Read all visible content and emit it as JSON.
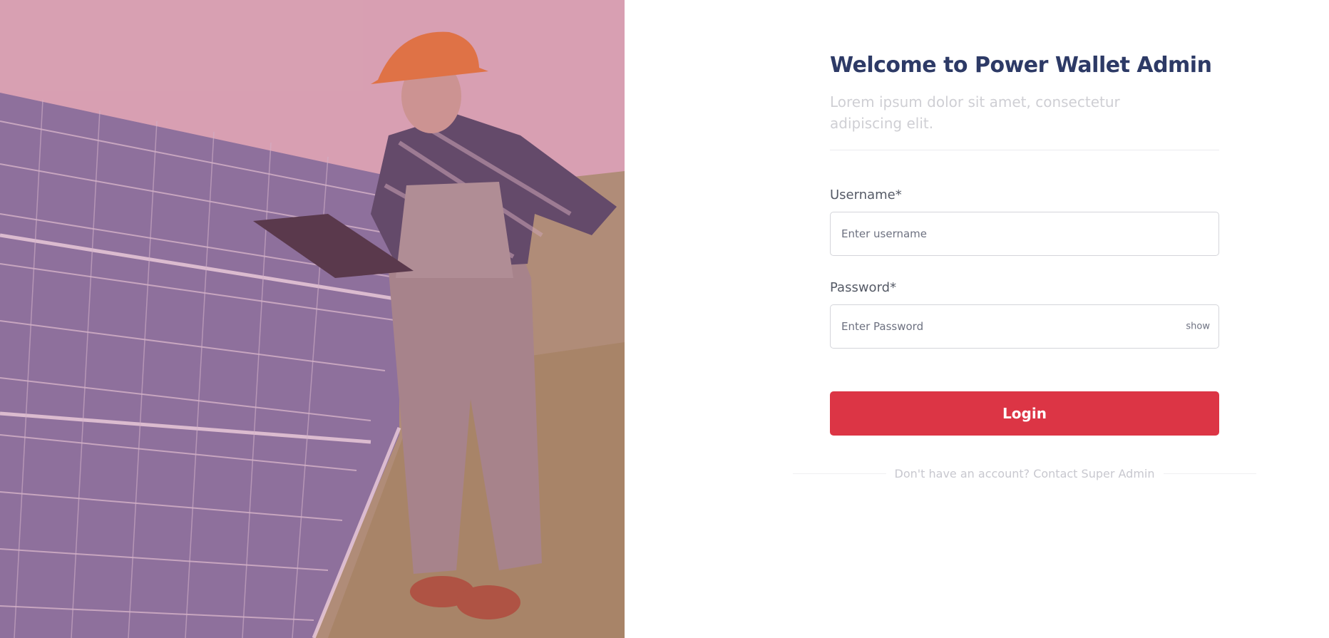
{
  "hero": {
    "image_alt": "Worker in hard hat holding clipboard beside solar panels"
  },
  "form": {
    "title": "Welcome to Power Wallet Admin",
    "subtitle": "Lorem ipsum dolor sit amet, consectetur adipiscing elit.",
    "username": {
      "label": "Username*",
      "placeholder": "Enter username",
      "value": ""
    },
    "password": {
      "label": "Password*",
      "placeholder": "Enter Password",
      "value": "",
      "toggle_label": "show"
    },
    "login_label": "Login",
    "footer_text": "Don't have an account? Contact Super Admin"
  },
  "colors": {
    "primary_button": "#dc3545",
    "title": "#2d3a66",
    "subtitle": "#cfcfd4"
  }
}
